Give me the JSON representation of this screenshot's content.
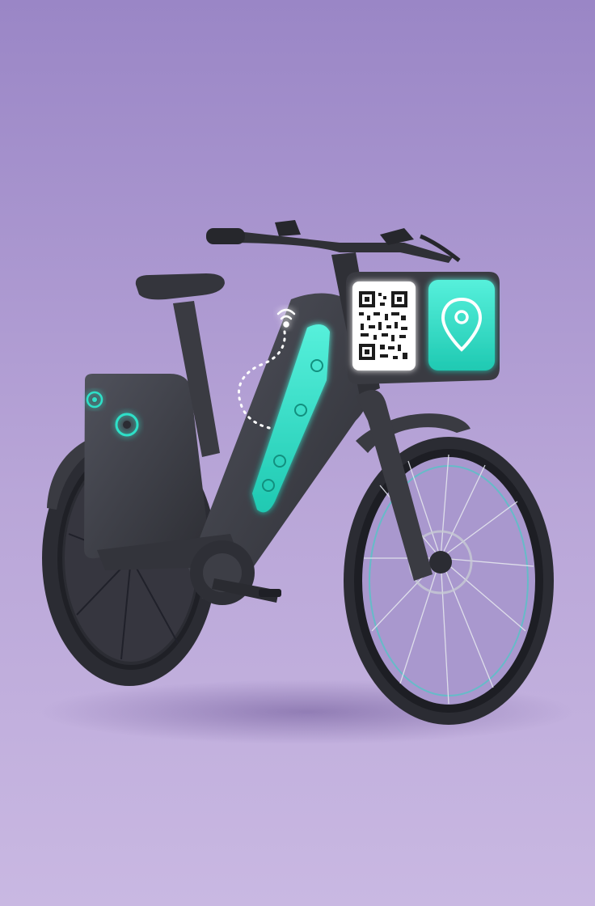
{
  "scene": {
    "subject": "electric-bike",
    "colors": {
      "background_top": "#9a86c6",
      "background_bottom": "#c9b8e2",
      "frame": "#3a3b42",
      "frame_highlight": "#4b4d57",
      "accent": "#2fe0c8",
      "accent_dark": "#19b8a3",
      "tire": "#2b2c33",
      "spoke": "#d9dde6",
      "qr_dark": "#1c1c1c",
      "qr_light": "#ffffff"
    },
    "icons": [
      "wifi-signal-icon",
      "map-pin-icon",
      "qr-code",
      "lock-icon",
      "battery-indicator-icon"
    ]
  }
}
